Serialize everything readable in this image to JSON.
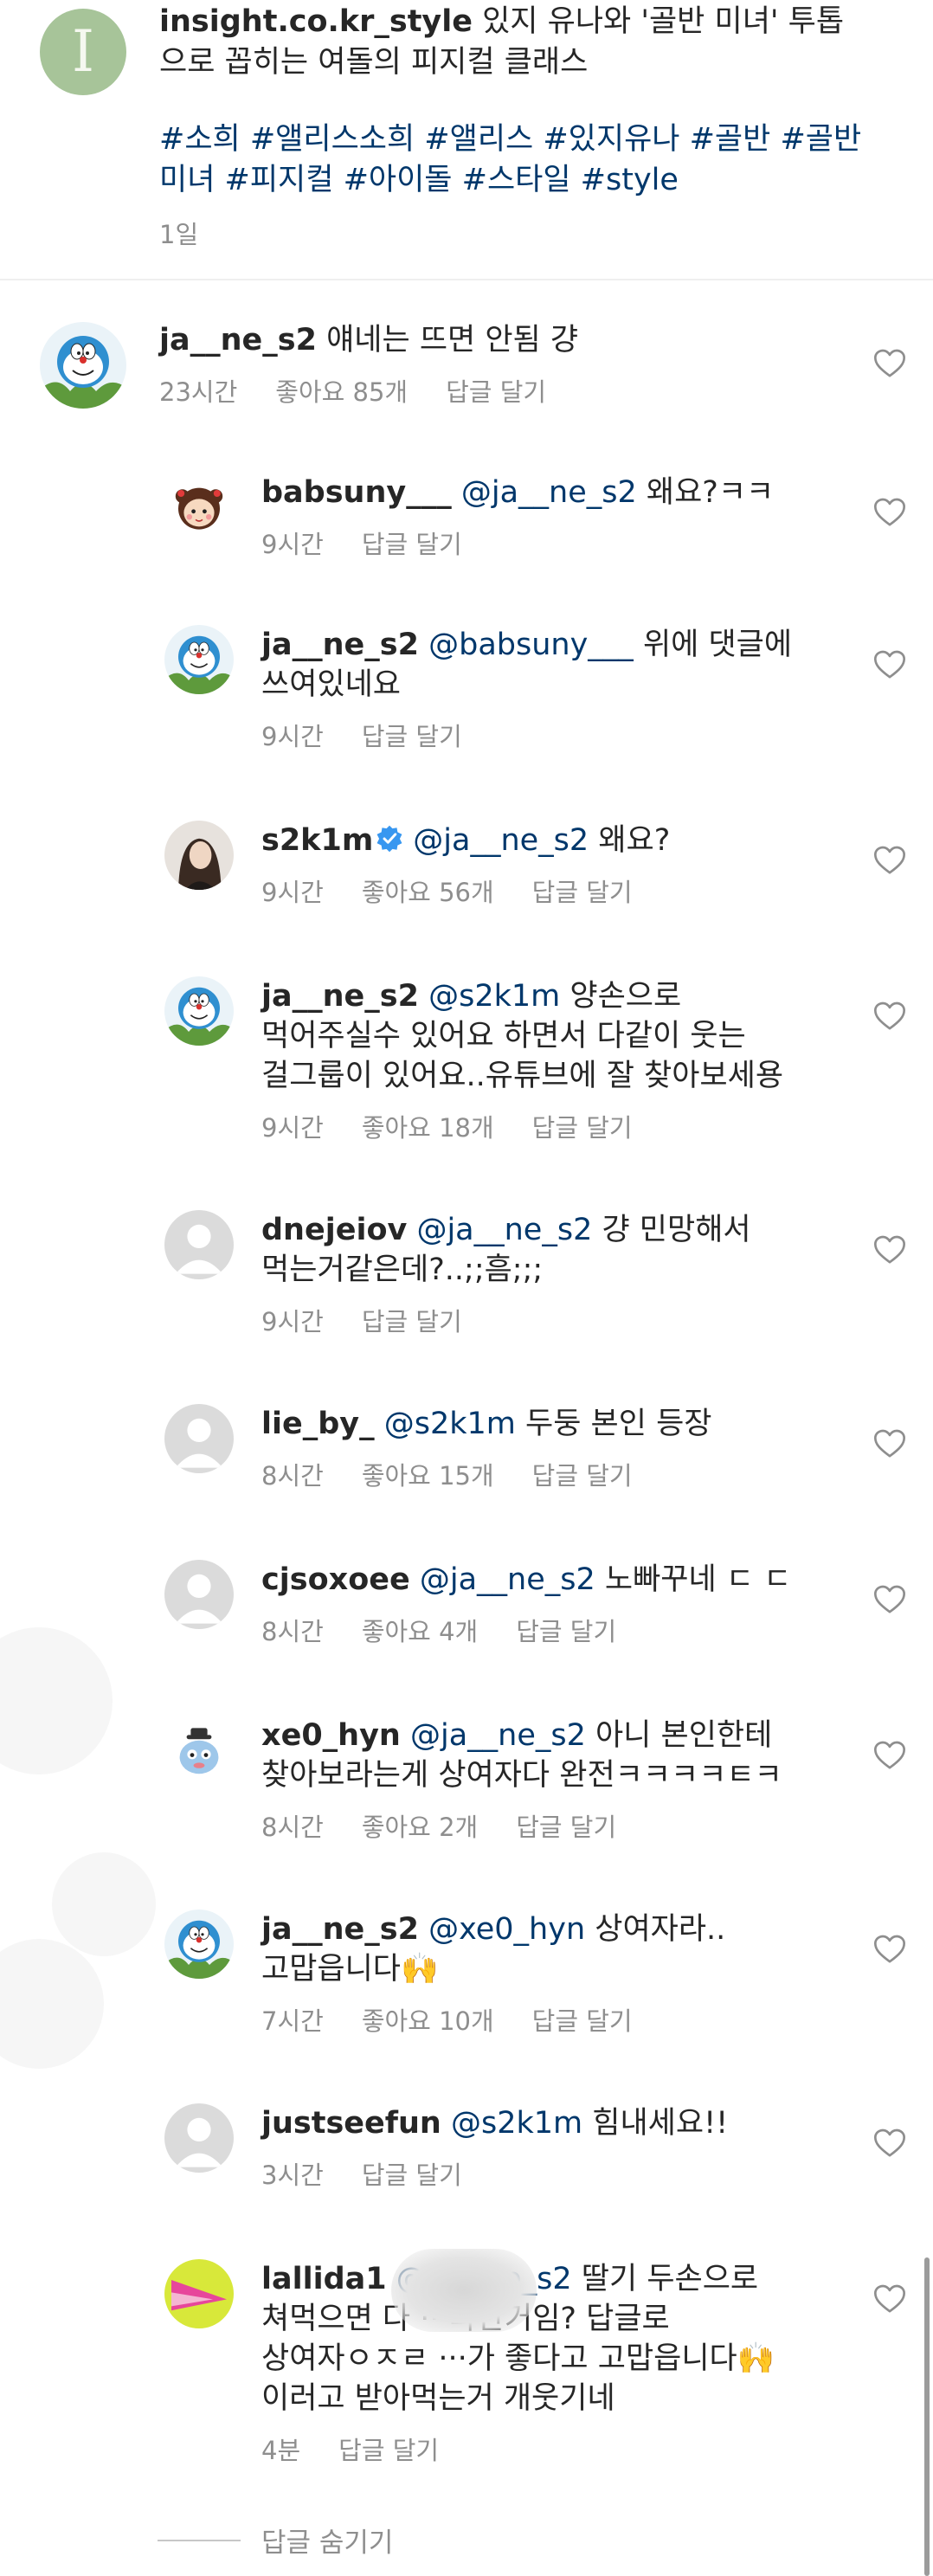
{
  "caption": {
    "username": "insight.co.kr_style",
    "text": " 있지 유나와 '골반 미녀' 투톱으로 꼽히는 여돌의 피지컬 클래스",
    "hashtags": "#소희 #앨리스소희 #앨리스 #있지유나 #골반 #골반미녀 #피지컬 #아이돌 #스타일 #style",
    "time": "1일",
    "avatar_letter": "I"
  },
  "comments": [
    {
      "username": "ja__ne_s2",
      "mention": "",
      "text": "얘네는 뜨면 안됨 걍",
      "time": "23시간",
      "likes": "좋아요 85개",
      "reply": "답글 달기",
      "avatar": "doraemon-icon"
    },
    {
      "username": "babsuny___",
      "mention": "@ja__ne_s2",
      "text": " 왜요?ㅋㅋ",
      "time": "9시간",
      "likes": "",
      "reply": "답글 달기",
      "avatar": "cartoon-girl-icon"
    },
    {
      "username": "ja__ne_s2",
      "mention": "@babsuny___",
      "text": " 위에 댓글에 쓰여있네요",
      "time": "9시간",
      "likes": "",
      "reply": "답글 달기",
      "avatar": "doraemon-icon"
    },
    {
      "username": "s2k1m",
      "mention": "@ja__ne_s2",
      "text": " 왜요?",
      "time": "9시간",
      "likes": "좋아요 56개",
      "reply": "답글 달기",
      "avatar": "profile-photo-icon",
      "verified": true
    },
    {
      "username": "ja__ne_s2",
      "mention": "@s2k1m",
      "text": " 양손으로 먹어주실수 있어요 하면서 다같이 웃는 걸그룹이 있어요..유튜브에 잘 찾아보세용",
      "time": "9시간",
      "likes": "좋아요 18개",
      "reply": "답글 달기",
      "avatar": "doraemon-icon"
    },
    {
      "username": "dnejeiov",
      "mention": "@ja__ne_s2",
      "text": " 걍 민망해서 먹는거같은데?..;;흠;;;",
      "time": "9시간",
      "likes": "",
      "reply": "답글 달기",
      "avatar": "default-avatar-icon"
    },
    {
      "username": "lie_by_",
      "mention": "@s2k1m",
      "text": " 두둥 본인 등장",
      "time": "8시간",
      "likes": "좋아요 15개",
      "reply": "답글 달기",
      "avatar": "default-avatar-icon"
    },
    {
      "username": "cjsoxoee",
      "mention": "@ja__ne_s2",
      "text": " 노빠꾸네 ㄷ ㄷ",
      "time": "8시간",
      "likes": "좋아요 4개",
      "reply": "답글 달기",
      "avatar": "default-avatar-icon"
    },
    {
      "username": "xe0_hyn",
      "mention": "@ja__ne_s2",
      "text": " 아니 본인한테 찾아보라는게 상여자다 완전ㅋㅋㅋㅋㅌㅋ",
      "time": "8시간",
      "likes": "좋아요 2개",
      "reply": "답글 달기",
      "avatar": "cartoon-character-icon"
    },
    {
      "username": "ja__ne_s2",
      "mention": "@xe0_hyn",
      "text": " 상여자라..고맙읍니다🙌",
      "time": "7시간",
      "likes": "좋아요 10개",
      "reply": "답글 달기",
      "avatar": "doraemon-icon"
    },
    {
      "username": "justseefun",
      "mention": "@s2k1m",
      "text": " 힘내세요!!",
      "time": "3시간",
      "likes": "",
      "reply": "답글 달기",
      "avatar": "default-avatar-icon"
    },
    {
      "username": "lallida1",
      "mention": "@ja__ne_s2",
      "text": " 딸기 두손으로 쳐먹으면 다 ···라한거임? 답글로 상여자ㅇㅈㄹ ···가 좋다고 고맙읍니다🙌이러고 받아먹는거 개웃기네",
      "time": "4분",
      "likes": "",
      "reply": "답글 달기",
      "avatar": "colorful-logo-icon"
    }
  ],
  "hide_replies": "답글 숨기기",
  "colors": {
    "username": "#262626",
    "mention": "#00376b",
    "meta": "#8e8e8e",
    "verified": "#3897f0"
  }
}
